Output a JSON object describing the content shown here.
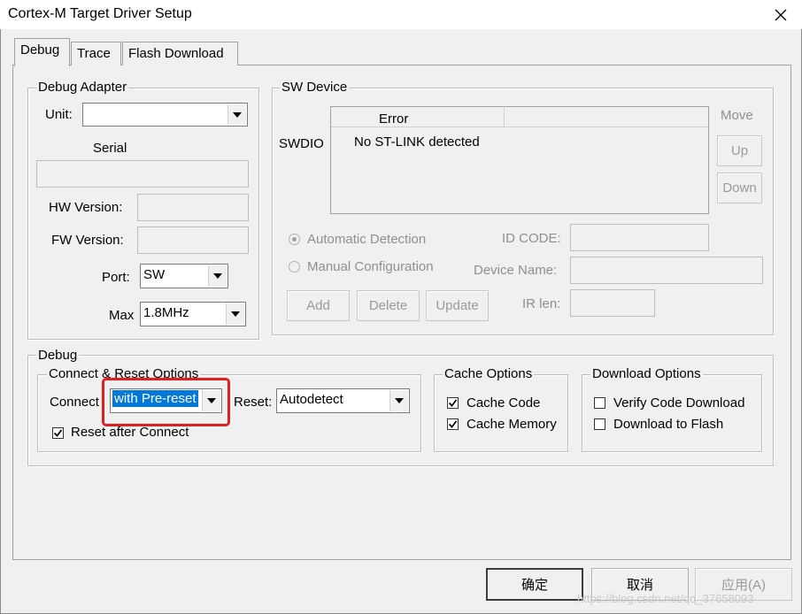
{
  "window": {
    "title": "Cortex-M Target Driver Setup"
  },
  "tabs": [
    "Debug",
    "Trace",
    "Flash Download"
  ],
  "debug_adapter": {
    "legend": "Debug Adapter",
    "unit_label": "Unit:",
    "unit_value": "",
    "serial_label": "Serial",
    "hw_label": "HW Version:",
    "fw_label": "FW Version:",
    "port_label": "Port:",
    "port_value": "SW",
    "max_label": "Max",
    "max_value": "1.8MHz"
  },
  "sw_device": {
    "legend": "SW Device",
    "swdio_label": "SWDIO",
    "col_error": "Error",
    "row_text": "No ST-LINK detected",
    "move_label": "Move",
    "up_label": "Up",
    "down_label": "Down",
    "auto_detect": "Automatic Detection",
    "manual_config": "Manual Configuration",
    "id_code_label": "ID CODE:",
    "device_name_label": "Device Name:",
    "ir_len_label": "IR len:",
    "add_label": "Add",
    "delete_label": "Delete",
    "update_label": "Update"
  },
  "debug": {
    "legend": "Debug",
    "connect_reset": {
      "legend": "Connect & Reset Options",
      "connect_label": "Connect",
      "connect_value": "with Pre-reset",
      "reset_label": "Reset:",
      "reset_value": "Autodetect",
      "reset_after_connect": "Reset after Connect",
      "reset_after_connect_checked": true
    },
    "cache": {
      "legend": "Cache Options",
      "cache_code": "Cache Code",
      "cache_code_checked": true,
      "cache_memory": "Cache Memory",
      "cache_memory_checked": true
    },
    "download": {
      "legend": "Download Options",
      "verify": "Verify Code Download",
      "verify_checked": false,
      "to_flash": "Download to Flash",
      "to_flash_checked": false
    }
  },
  "footer": {
    "ok": "确定",
    "cancel": "取消",
    "apply": "应用(A)",
    "watermark": "https://blog.csdn.net/qq_37658093"
  },
  "colors": {
    "highlight": "#0078d7",
    "annotation": "#e02020"
  }
}
